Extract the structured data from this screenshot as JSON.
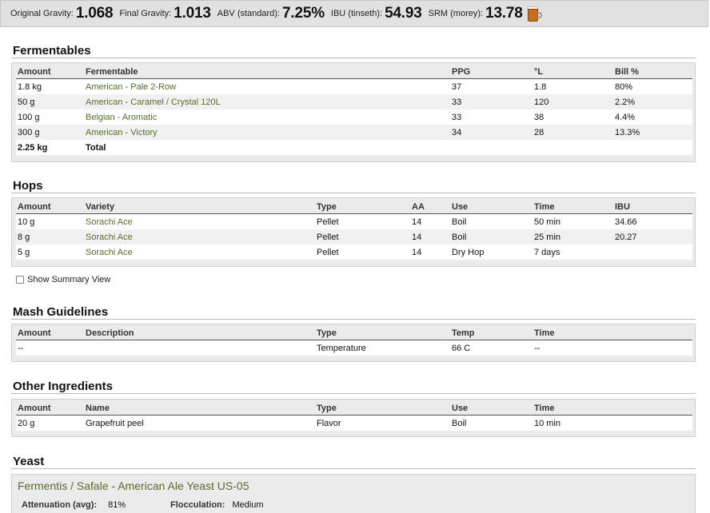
{
  "stats": [
    {
      "label": "Original Gravity:",
      "value": "1.068"
    },
    {
      "label": "Final Gravity:",
      "value": "1.013"
    },
    {
      "label": "ABV (standard):",
      "value": "7.25%"
    },
    {
      "label": "IBU (tinseth):",
      "value": "54.93"
    },
    {
      "label": "SRM (morey):",
      "value": "13.78"
    }
  ],
  "beer_color": "#c46d1f",
  "fermentables": {
    "title": "Fermentables",
    "headers": [
      "Amount",
      "Fermentable",
      "PPG",
      "°L",
      "Bill %"
    ],
    "rows": [
      [
        "1.8 kg",
        "American - Pale 2-Row",
        "37",
        "1.8",
        "80%"
      ],
      [
        "50 g",
        "American - Caramel / Crystal 120L",
        "33",
        "120",
        "2.2%"
      ],
      [
        "100 g",
        "Belgian - Aromatic",
        "33",
        "38",
        "4.4%"
      ],
      [
        "300 g",
        "American - Victory",
        "34",
        "28",
        "13.3%"
      ]
    ],
    "total": [
      "2.25 kg",
      "Total"
    ]
  },
  "hops": {
    "title": "Hops",
    "headers": [
      "Amount",
      "Variety",
      "Type",
      "AA",
      "Use",
      "Time",
      "IBU"
    ],
    "rows": [
      [
        "10 g",
        "Sorachi Ace",
        "Pellet",
        "14",
        "Boil",
        "50 min",
        "34.66"
      ],
      [
        "8 g",
        "Sorachi Ace",
        "Pellet",
        "14",
        "Boil",
        "25 min",
        "20.27"
      ],
      [
        "5 g",
        "Sorachi Ace",
        "Pellet",
        "14",
        "Dry Hop",
        "7 days",
        ""
      ]
    ]
  },
  "summary_toggle": "Show Summary View",
  "mash": {
    "title": "Mash Guidelines",
    "headers": [
      "Amount",
      "Description",
      "Type",
      "Temp",
      "Time"
    ],
    "rows": [
      [
        "--",
        "",
        "Temperature",
        "66 C",
        "--"
      ]
    ]
  },
  "other": {
    "title": "Other Ingredients",
    "headers": [
      "Amount",
      "Name",
      "Type",
      "Use",
      "Time"
    ],
    "rows": [
      [
        "20 g",
        "Grapefruit peel",
        "Flavor",
        "Boil",
        "10 min"
      ]
    ]
  },
  "yeast": {
    "title": "Yeast",
    "name": "Fermentis / Safale - American Ale Yeast US-05",
    "attenuation_label": "Attenuation (avg):",
    "attenuation": "81%",
    "flocculation_label": "Flocculation:",
    "flocculation": "Medium"
  }
}
